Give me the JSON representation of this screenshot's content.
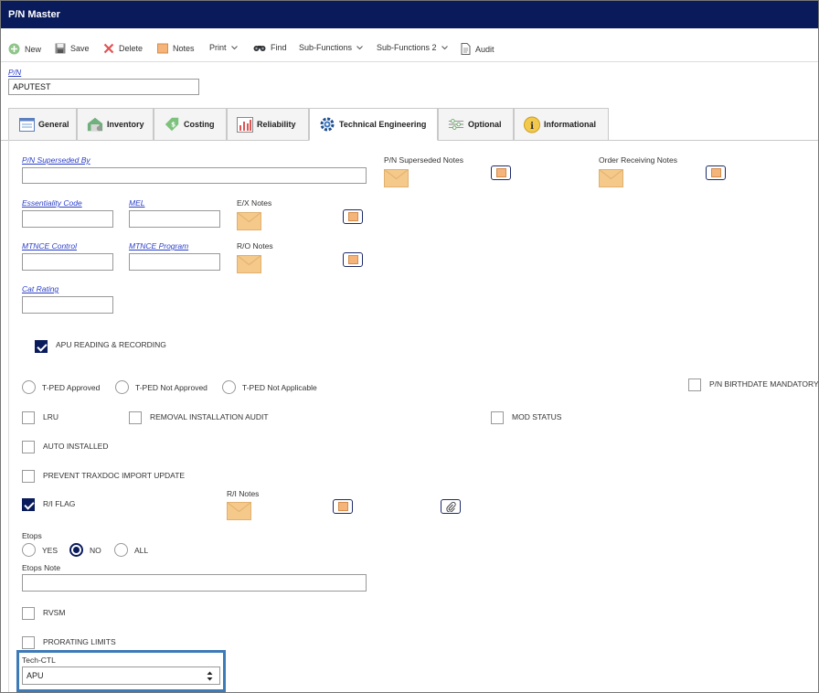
{
  "window": {
    "title": "P/N Master"
  },
  "toolbar": {
    "new": "New",
    "save": "Save",
    "delete": "Delete",
    "notes": "Notes",
    "print": "Print",
    "find": "Find",
    "sub_functions": "Sub-Functions",
    "sub_functions_2": "Sub-Functions 2",
    "audit": "Audit"
  },
  "pn": {
    "label": "P/N",
    "value": "APUTEST"
  },
  "tabs": [
    {
      "label": "General"
    },
    {
      "label": "Inventory"
    },
    {
      "label": "Costing"
    },
    {
      "label": "Reliability"
    },
    {
      "label": "Technical Engineering"
    },
    {
      "label": "Optional"
    },
    {
      "label": "Informational"
    }
  ],
  "fields": {
    "pn_superseded_by": {
      "label": "P/N Superseded By",
      "value": ""
    },
    "essentiality_code": {
      "label": "Essentiality Code",
      "value": ""
    },
    "mel": {
      "label": "MEL",
      "value": ""
    },
    "mtnce_control": {
      "label": "MTNCE Control",
      "value": ""
    },
    "mtnce_program": {
      "label": "MTNCE Program",
      "value": ""
    },
    "cat_rating": {
      "label": "Cat Rating",
      "value": ""
    }
  },
  "notes": {
    "pn_superseded_notes": "P/N Superseded Notes",
    "order_receiving_notes": "Order Receiving Notes",
    "ex_notes": "E/X Notes",
    "ro_notes": "R/O Notes",
    "ri_notes": "R/I Notes"
  },
  "checks": {
    "apu_reading": {
      "label": "APU READING & RECORDING",
      "checked": true
    },
    "pn_birthdate": {
      "label": "P/N BIRTHDATE MANDATORY",
      "checked": false
    },
    "lru": {
      "label": "LRU",
      "checked": false
    },
    "removal_audit": {
      "label": "REMOVAL INSTALLATION AUDIT",
      "checked": false
    },
    "mod_status": {
      "label": "MOD STATUS",
      "checked": false
    },
    "auto_installed": {
      "label": "AUTO INSTALLED",
      "checked": false
    },
    "prevent_traxdoc": {
      "label": "PREVENT TRAXDOC IMPORT UPDATE",
      "checked": false
    },
    "ri_flag": {
      "label": "R/I FLAG",
      "checked": true
    },
    "rvsm": {
      "label": "RVSM",
      "checked": false
    },
    "prorating": {
      "label": "PRORATING LIMITS",
      "checked": false
    }
  },
  "tped": {
    "approved": "T-PED Approved",
    "not_approved": "T-PED Not Approved",
    "not_applicable": "T-PED Not Applicable"
  },
  "etops": {
    "label": "Etops",
    "yes": "YES",
    "no": "NO",
    "all": "ALL",
    "selected": "NO",
    "note_label": "Etops Note",
    "note_value": ""
  },
  "tech_ctl": {
    "label": "Tech-CTL",
    "value": "APU"
  },
  "colors": {
    "title_bar": "#0a1b5c",
    "link_label": "#2b3fc8",
    "highlight": "#3d7ab8"
  }
}
